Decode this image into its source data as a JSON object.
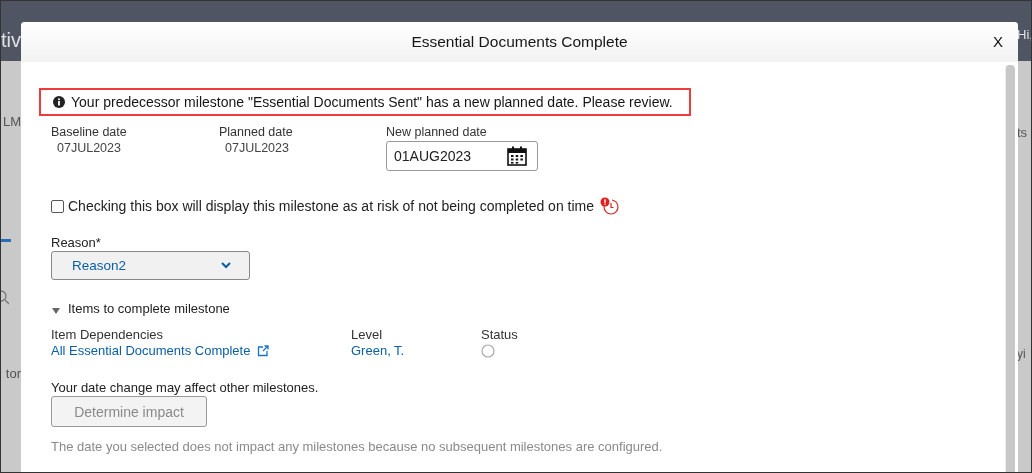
{
  "backdrop": {
    "left_fragments": [
      "tiv",
      "LM",
      "tor"
    ],
    "right_fragments": [
      "Hi,",
      "ts",
      "yi"
    ]
  },
  "dialog": {
    "title": "Essential Documents Complete",
    "close_label": "X"
  },
  "alert": {
    "text": "Your predecessor milestone \"Essential Documents Sent\" has a new planned date. Please review."
  },
  "dates": [
    {
      "label": "Baseline date",
      "value": "07JUL2023",
      "kind": "text"
    },
    {
      "label": "Planned date",
      "value": "07JUL2023",
      "kind": "text"
    },
    {
      "label": "New planned date",
      "value": "01AUG2023",
      "kind": "date_input"
    }
  ],
  "at_risk": {
    "label": "Checking this box will display this milestone as at risk of not being completed on time",
    "checked": false
  },
  "reason": {
    "label": "Reason*",
    "value": "Reason2"
  },
  "items_section": {
    "title": "Items to complete milestone",
    "expanded": true,
    "columns": [
      "Item Dependencies",
      "Level",
      "Status"
    ],
    "rows": [
      {
        "item": "All Essential Documents Complete",
        "level": "Green, T.",
        "complete": false
      }
    ]
  },
  "impact": {
    "prompt": "Your date change may affect other milestones.",
    "button": "Determine impact",
    "button_disabled": true,
    "note": "The date you selected does not impact any milestones because no subsequent milestones are configured."
  }
}
